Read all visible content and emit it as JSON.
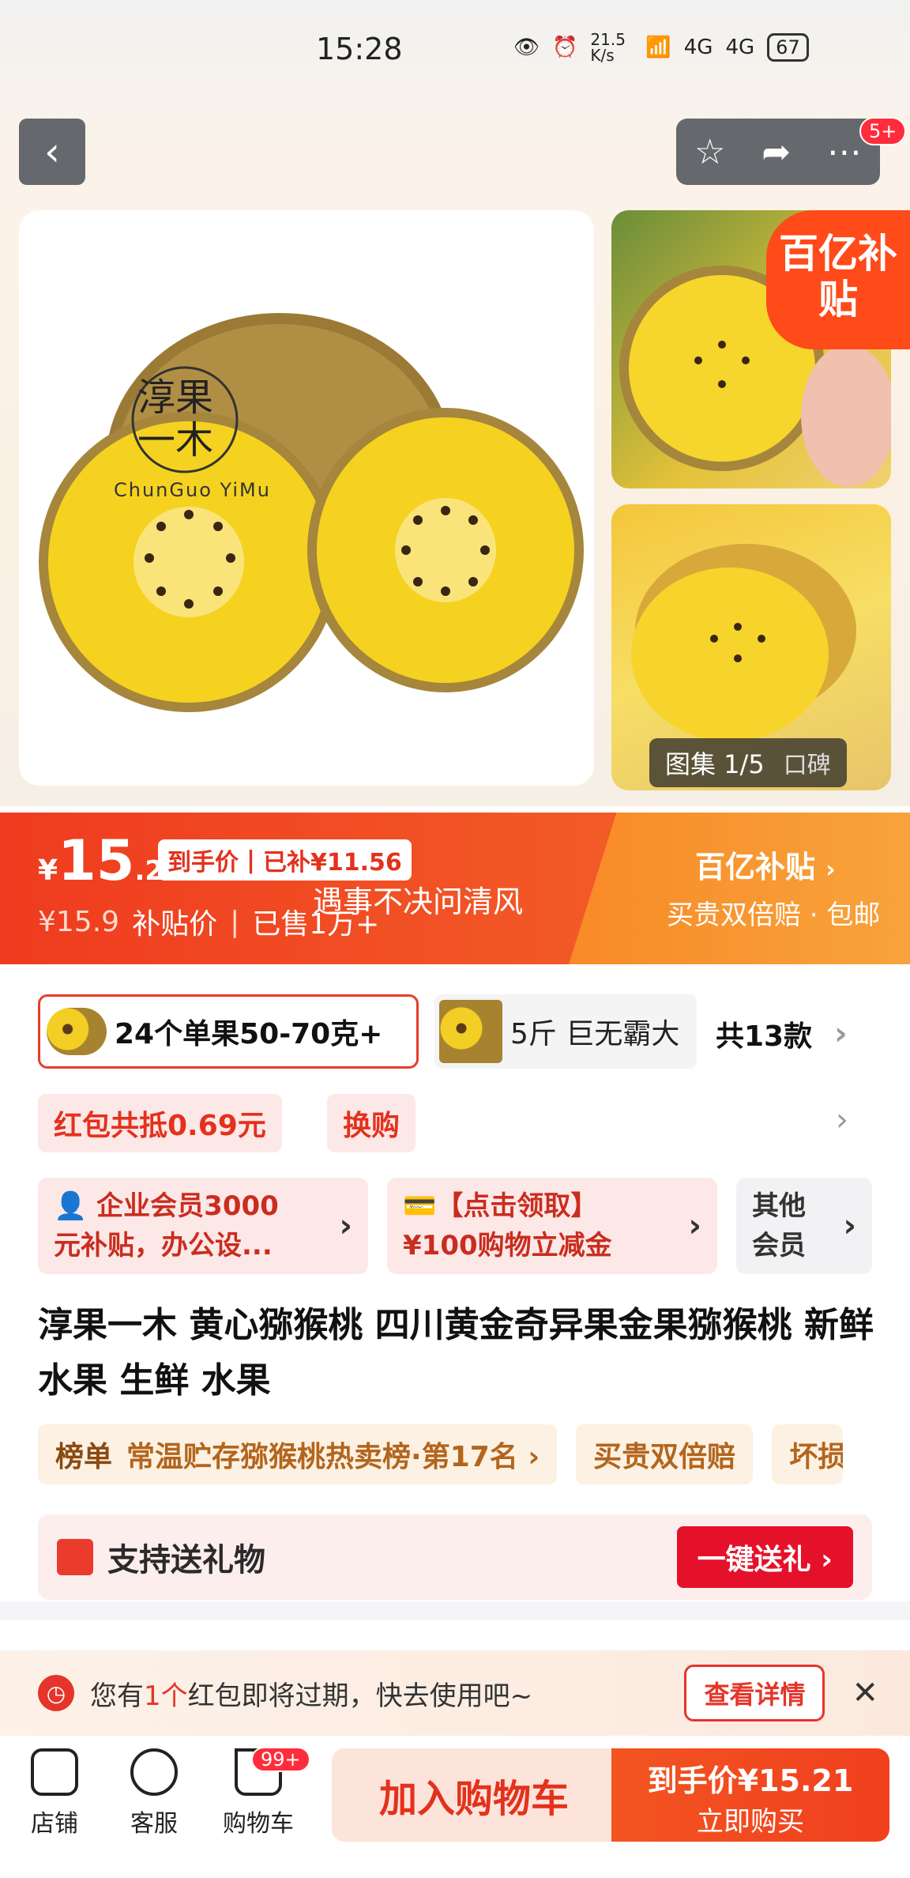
{
  "status": {
    "time": "15:28",
    "speed": "21.5 K/s",
    "net1": "4G",
    "net2": "4G",
    "battery": "67"
  },
  "header": {
    "back_icon": "chevron-left",
    "tools": [
      "star-icon",
      "share-icon",
      "more-icon"
    ],
    "badge": "5+"
  },
  "gallery": {
    "logo_text": "淳果 一木",
    "logo_sub": "ChunGuo YiMu",
    "subsidy_tag": "百亿补贴",
    "counter": "图集 1/5",
    "koubei": "口碑"
  },
  "price": {
    "currency": "¥",
    "int": "15",
    "dec": ".21",
    "tag_left": "到手价",
    "tag_right": "已补¥11.56",
    "orig": "¥15.9",
    "orig_label": "补贴价",
    "sold": "已售1万+",
    "overlay": "遇事不决问清风",
    "brand": "百亿补贴",
    "guarantee": "买贵双倍赔 · 包邮"
  },
  "spec": {
    "selected": "24个单果50-70克+",
    "option2": "5斤 巨无霸大",
    "count": "共13款"
  },
  "coupons": {
    "redpacket": "红包共抵0.69元",
    "exchange": "换购"
  },
  "members": [
    {
      "line1": "企业会员3000",
      "line2": "元补贴，办公设..."
    },
    {
      "line1": "【点击领取】",
      "line2": "¥100购物立减金"
    },
    {
      "line1": "其他",
      "line2": "会员"
    }
  ],
  "title": "淳果一木 黄心猕猴桃 四川黄金奇异果金果猕猴桃 新鲜水果 生鲜 水果",
  "tags": {
    "rank_label": "榜单",
    "rank_text": "常温贮存猕猴桃热卖榜·第17名 ›",
    "guarantee": "买贵双倍赔",
    "damage": "坏损"
  },
  "gift": {
    "text": "支持送礼物",
    "button": "一键送礼 ›"
  },
  "notice": {
    "pre": "您有",
    "num": "1个",
    "post": "红包即将过期，快去使用吧~",
    "button": "查看详情",
    "close": "✕"
  },
  "bottom_nav": {
    "store": "店铺",
    "service": "客服",
    "cart": "购物车",
    "cart_badge": "99+",
    "add_cart": "加入购物车",
    "buy_price": "到手价¥15.21",
    "buy_label": "立即购买"
  },
  "colors": {
    "accent": "#e4311d",
    "orange": "#f7a33b",
    "kiwi_yellow": "#f3cf25"
  }
}
